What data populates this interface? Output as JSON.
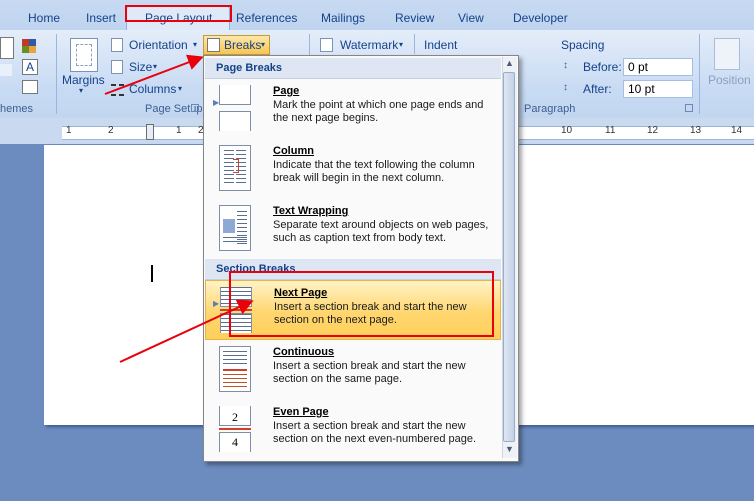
{
  "tabs": [
    "Home",
    "Insert",
    "Page Layout",
    "References",
    "Mailings",
    "Review",
    "View",
    "Developer"
  ],
  "ribbon": {
    "themes_label": "hemes",
    "margins": "Margins",
    "orientation": "Orientation",
    "size": "Size",
    "columns": "Columns",
    "breaks": "Breaks",
    "page_setup": "Page Setup",
    "watermark": "Watermark",
    "indent": "Indent",
    "spacing": "Spacing",
    "before_label": "Before:",
    "before_value": "0 pt",
    "after_label": "After:",
    "after_value": "10 pt",
    "paragraph": "Paragraph",
    "position": "Position"
  },
  "ruler_numbers": [
    "1",
    "2",
    "1",
    "2",
    "10",
    "11",
    "12",
    "13",
    "14"
  ],
  "menu": {
    "page_breaks_header": "Page Breaks",
    "section_breaks_header": "Section Breaks",
    "items": [
      {
        "title": "Page",
        "desc": "Mark the point at which one page ends and the next page begins."
      },
      {
        "title": "Column",
        "desc": "Indicate that the text following the column break will begin in the next column."
      },
      {
        "title": "Text Wrapping",
        "desc": "Separate text around objects on web pages, such as caption text from body text."
      },
      {
        "title": "Next Page",
        "desc": "Insert a section break and start the new section on the next page."
      },
      {
        "title": "Continuous",
        "desc": "Insert a section break and start the new section on the same page."
      },
      {
        "title": "Even Page",
        "desc": "Insert a section break and start the new section on the next even-numbered page."
      }
    ],
    "even_page_numbers": [
      "2",
      "4"
    ]
  },
  "colors": {
    "annotation_red": "#e8000b",
    "highlight": "#ffd66f"
  }
}
